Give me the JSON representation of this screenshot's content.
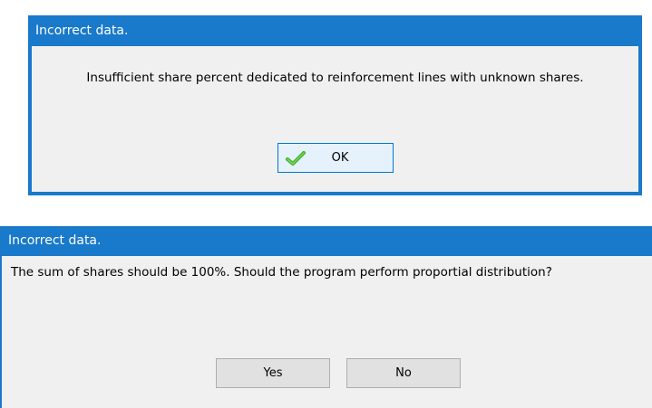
{
  "dialogs": [
    {
      "title": "Incorrect data.",
      "message": "Insufficient share percent dedicated to reinforcement lines with unknown shares.",
      "buttons": [
        {
          "label": "OK",
          "icon": "checkmark-icon"
        }
      ]
    },
    {
      "title": "Incorrect data.",
      "message": "The sum of shares should be 100%. Should the program perform proportial distribution?",
      "buttons": [
        {
          "label": "Yes"
        },
        {
          "label": "No"
        }
      ]
    }
  ],
  "colors": {
    "titlebar": "#1979ca",
    "dialog_background": "#f0f0f0",
    "button_background": "#e1e1e1",
    "button_focus_border": "#0078d7",
    "checkmark": "#3fae2a"
  }
}
